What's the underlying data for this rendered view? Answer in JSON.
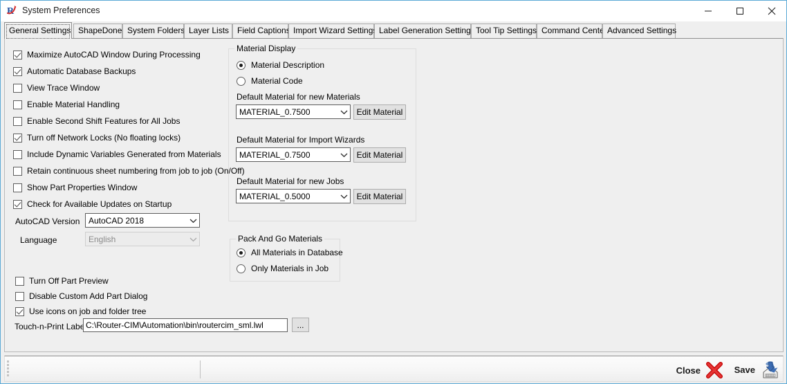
{
  "window": {
    "title": "System Preferences",
    "app_icon": "routercim-r-icon",
    "caption_buttons": [
      {
        "name": "minimize-button",
        "glyph": "minimize-icon"
      },
      {
        "name": "maximize-button",
        "glyph": "maximize-icon"
      },
      {
        "name": "close-button",
        "glyph": "close-icon"
      }
    ],
    "border_color": "#5aa9d6",
    "background": "#efefef"
  },
  "tabs": [
    {
      "label": "General Settings",
      "active": true
    },
    {
      "label": "ShapeDone",
      "active": false
    },
    {
      "label": "System Folders",
      "active": false
    },
    {
      "label": "Layer Lists",
      "active": false
    },
    {
      "label": "Field Captions",
      "active": false
    },
    {
      "label": "Import Wizard Settings",
      "active": false
    },
    {
      "label": "Label Generation Settings",
      "active": false
    },
    {
      "label": "Tool Tip Settings",
      "active": false
    },
    {
      "label": "Command Center",
      "active": false
    },
    {
      "label": "Advanced Settings",
      "active": false
    }
  ],
  "general_settings": {
    "checkboxes_top": [
      {
        "label": "Maximize AutoCAD Window During Processing",
        "checked": true
      },
      {
        "label": "Automatic Database Backups",
        "checked": true
      },
      {
        "label": "View Trace Window",
        "checked": false
      },
      {
        "label": "Enable Material Handling",
        "checked": false
      },
      {
        "label": "Enable Second Shift Features for All Jobs",
        "checked": false
      },
      {
        "label": "Turn off Network Locks (No floating locks)",
        "checked": true
      },
      {
        "label": "Include Dynamic Variables Generated from Materials",
        "checked": false
      },
      {
        "label": "Retain continuous sheet numbering from job to job (On/Off)",
        "checked": false
      },
      {
        "label": "Show Part Properties Window",
        "checked": false
      },
      {
        "label": "Check for Available Updates on Startup",
        "checked": true
      }
    ],
    "autocad_version": {
      "label": "AutoCAD Version",
      "value": "AutoCAD 2018",
      "disabled": false
    },
    "language": {
      "label": "Language",
      "value": "English",
      "disabled": true
    },
    "checkboxes_bottom": [
      {
        "label": "Turn Off Part Preview",
        "checked": false
      },
      {
        "label": "Disable Custom Add Part Dialog",
        "checked": false
      },
      {
        "label": "Use icons on job and folder tree",
        "checked": true
      }
    ],
    "touch_n_print": {
      "label": "Touch-n-Print Label",
      "value": "C:\\Router-CIM\\Automation\\bin\\routercim_sml.lwl",
      "browse_label": "..."
    }
  },
  "material_display": {
    "title": "Material Display",
    "radios": [
      {
        "label": "Material Description",
        "selected": true
      },
      {
        "label": "Material Code",
        "selected": false
      }
    ],
    "fields": [
      {
        "label": "Default Material for new Materials",
        "value": "MATERIAL_0.7500",
        "button": "Edit Material"
      },
      {
        "label": "Default Material for Import Wizards",
        "value": "MATERIAL_0.7500",
        "button": "Edit Material"
      },
      {
        "label": "Default Material for new Jobs",
        "value": "MATERIAL_0.5000",
        "button": "Edit Material"
      }
    ]
  },
  "pack_and_go": {
    "title": "Pack And Go Materials",
    "radios": [
      {
        "label": "All Materials in Database",
        "selected": true
      },
      {
        "label": "Only Materials in Job",
        "selected": false
      }
    ]
  },
  "statusbar": {
    "close_label": "Close",
    "close_icon": "red-x-icon",
    "save_label": "Save",
    "save_icon": "save-disk-icon",
    "close_icon_color": "#cc0000",
    "save_icon_color": "#4a7ebb"
  }
}
